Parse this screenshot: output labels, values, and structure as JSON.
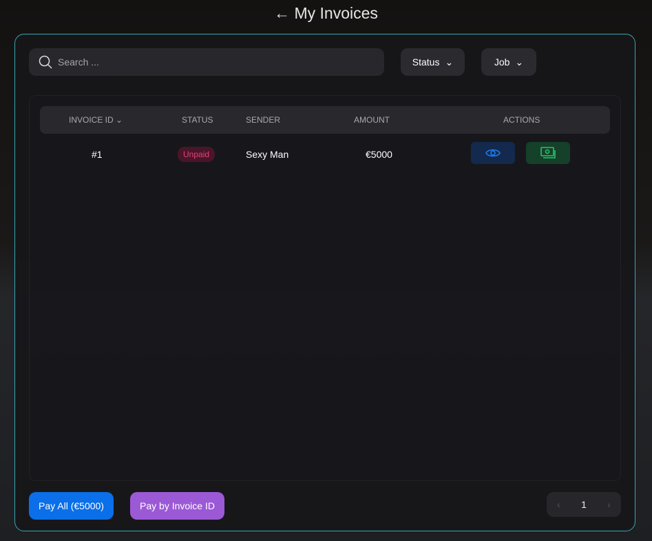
{
  "header": {
    "back_arrow": "←",
    "title": "My Invoices"
  },
  "search": {
    "placeholder": "Search ..."
  },
  "filters": {
    "status": "Status",
    "job": "Job"
  },
  "table": {
    "columns": [
      "INVOICE ID",
      "STATUS",
      "SENDER",
      "AMOUNT",
      "ACTIONS"
    ],
    "rows": [
      {
        "id": "#1",
        "status": "Unpaid",
        "sender": "Sexy Man",
        "amount": "€5000"
      }
    ]
  },
  "footer": {
    "pay_all": "Pay All (€5000)",
    "pay_by_id": "Pay by Invoice ID",
    "page": "1",
    "prev": "‹",
    "next": "›"
  },
  "colors": {
    "accent": "#3aa6b3",
    "pay_all": "#0a6fe8",
    "pay_by_id": "#9b59d6"
  }
}
